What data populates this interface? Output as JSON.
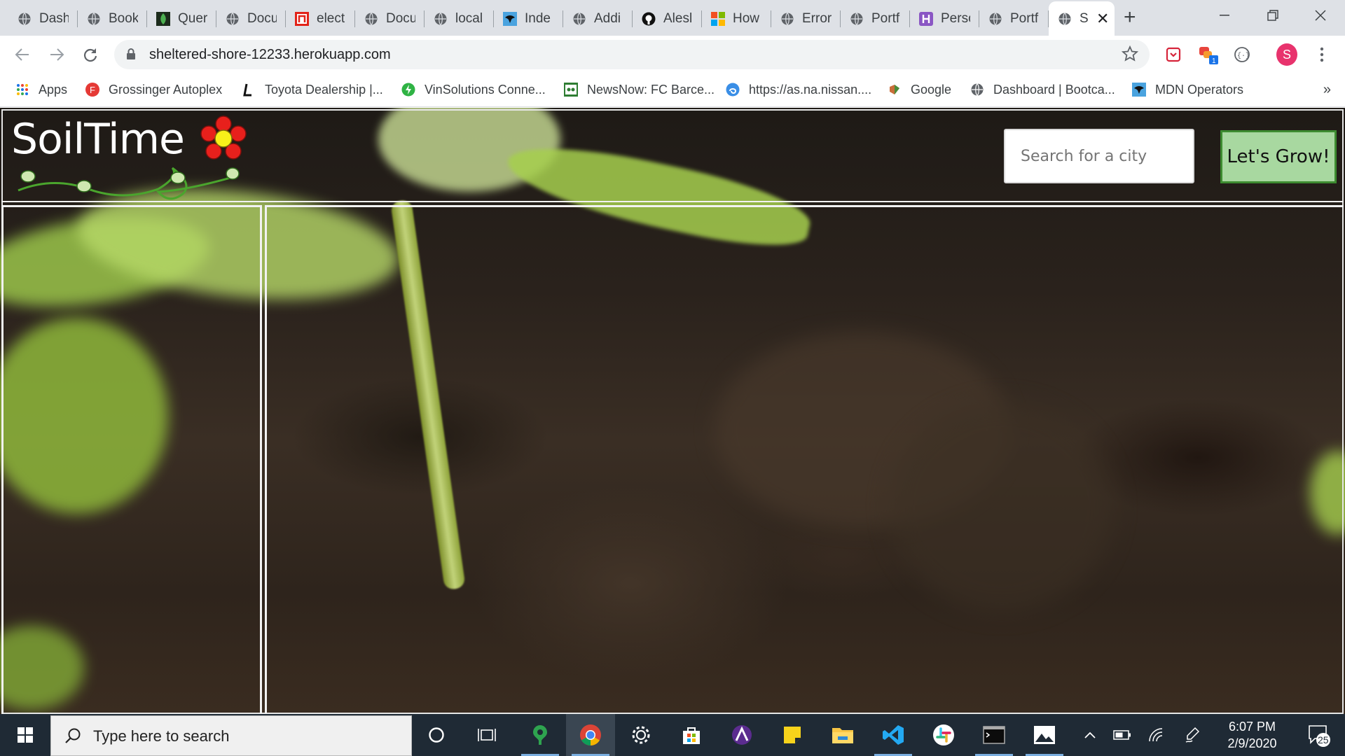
{
  "browser": {
    "tabs": [
      {
        "title": "Dash",
        "icon": "globe-icon"
      },
      {
        "title": "Book",
        "icon": "globe-icon"
      },
      {
        "title": "Quer",
        "icon": "leaf-icon"
      },
      {
        "title": "Docu",
        "icon": "globe-icon"
      },
      {
        "title": "elect",
        "icon": "red-n-icon"
      },
      {
        "title": "Docu",
        "icon": "globe-icon"
      },
      {
        "title": "local",
        "icon": "globe-icon"
      },
      {
        "title": "Inde",
        "icon": "bird-icon"
      },
      {
        "title": "Addi",
        "icon": "globe-icon"
      },
      {
        "title": "Alesl",
        "icon": "github-icon"
      },
      {
        "title": "How",
        "icon": "microsoft-icon"
      },
      {
        "title": "Error",
        "icon": "globe-icon"
      },
      {
        "title": "Portf",
        "icon": "globe-icon"
      },
      {
        "title": "Perso",
        "icon": "purple-h-icon"
      },
      {
        "title": "Portf",
        "icon": "globe-icon"
      },
      {
        "title": "S",
        "icon": "globe-icon",
        "active": true
      }
    ],
    "url": "sheltered-shore-12233.herokuapp.com",
    "profile_initial": "S",
    "bookmarks": [
      {
        "label": "Apps",
        "icon": "apps-grid-icon"
      },
      {
        "label": "Grossinger Autoplex",
        "icon": "red-f-icon"
      },
      {
        "label": "Toyota Dealership |...",
        "icon": "l-logo-icon"
      },
      {
        "label": "VinSolutions Conne...",
        "icon": "green-bolt-icon"
      },
      {
        "label": "NewsNow: FC Barce...",
        "icon": "newsnow-icon"
      },
      {
        "label": "https://as.na.nissan....",
        "icon": "blue-swirl-icon"
      },
      {
        "label": "Google",
        "icon": "google-icon"
      },
      {
        "label": "Dashboard | Bootca...",
        "icon": "globe-icon"
      },
      {
        "label": "MDN Operators",
        "icon": "bird-icon"
      }
    ],
    "bookmarks_overflow": "»"
  },
  "site": {
    "logo_text": "SoilTime",
    "search": {
      "placeholder": "Search for a city",
      "value": ""
    },
    "submit_label": "Let's Grow!"
  },
  "taskbar": {
    "search_placeholder": "Type here to search",
    "time": "6:07 PM",
    "date": "2/9/2020",
    "notification_count": "25"
  }
}
